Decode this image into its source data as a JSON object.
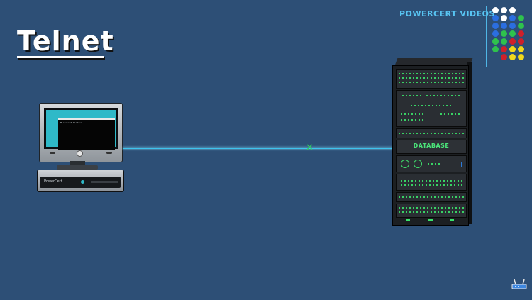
{
  "header": {
    "brand": "POWERCERT VIDEOS",
    "title": "Telnet"
  },
  "colors": {
    "background": "#2d4f76",
    "accent_line": "#4fb6e6",
    "brand_text": "#58c4f2",
    "connection": "#3ec4ee",
    "marker": "#2fd35a"
  },
  "logo_dots": [
    [
      "#ffffff",
      "#ffffff",
      "#ffffff",
      ""
    ],
    [
      "#2b6ee0",
      "#ffffff",
      "#2b6ee0",
      "#2fc24d"
    ],
    [
      "#2b6ee0",
      "#2b6ee0",
      "#2b6ee0",
      "#2fc24d"
    ],
    [
      "#2b6ee0",
      "#2fc24d",
      "#2fc24d",
      "#d0202a"
    ],
    [
      "#2fc24d",
      "#2fc24d",
      "#d0202a",
      "#d0202a"
    ],
    [
      "#2fc24d",
      "#d0202a",
      "#f0d81c",
      "#f0d81c"
    ],
    [
      "",
      "#d0202a",
      "#f0d81c",
      "#f0d81c"
    ]
  ],
  "client": {
    "icon": "desktop-computer-icon",
    "terminal_text": "Microsoft Windows",
    "tower_label": "PowerCert"
  },
  "server": {
    "icon": "server-rack-icon",
    "label": "DATABASE"
  },
  "connection": {
    "icon": "connection-marker-icon"
  },
  "corner_icon": "router-icon"
}
